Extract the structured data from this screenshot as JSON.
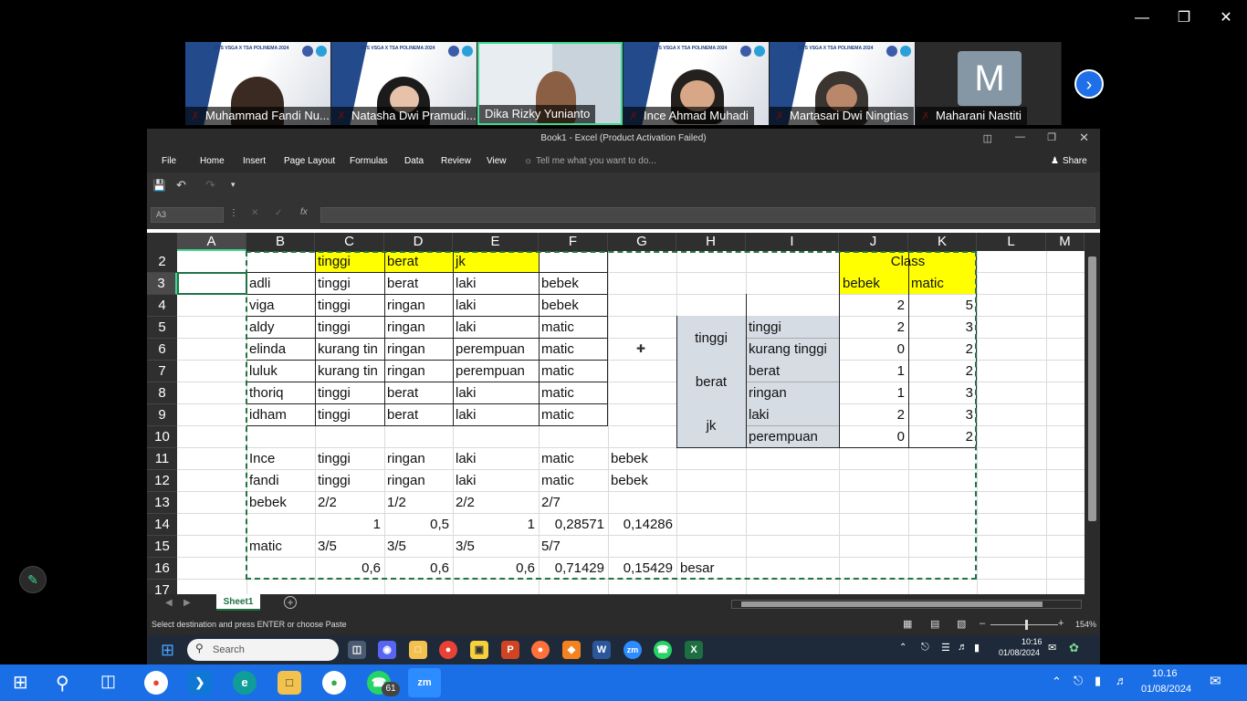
{
  "meeting": {
    "participants": [
      {
        "name": "Muhammad Fandi Nu...",
        "banner": "DTS VSGA X TSA POLINEMA 2024",
        "muted": true
      },
      {
        "name": "Natasha Dwi Pramudi...",
        "banner": "DTS VSGA X TSA POLINEMA 2024",
        "muted": true
      },
      {
        "name": "Dika Rizky Yunianto",
        "banner": "",
        "muted": false,
        "active": true
      },
      {
        "name": "Ince Ahmad Muhadi",
        "banner": "DTS VSGA X TSA POLINEMA 2024",
        "muted": true
      },
      {
        "name": "Martasari Dwi Ningtias",
        "banner": "DTS VSGA X TSA POLINEMA 2024",
        "muted": true
      },
      {
        "name": "Maharani Nastiti",
        "avatar_letter": "M",
        "muted": true
      }
    ],
    "next_icon": "chevron-right-icon"
  },
  "excel": {
    "title": "Book1 - Excel (Product Activation Failed)",
    "menu": [
      "File",
      "Home",
      "Insert",
      "Page Layout",
      "Formulas",
      "Data",
      "Review",
      "View"
    ],
    "tell_me": "Tell me what you want to do...",
    "share": "Share",
    "name_box": "A3",
    "formula_value": "",
    "columns": [
      "A",
      "B",
      "C",
      "D",
      "E",
      "F",
      "G",
      "H",
      "I",
      "J",
      "K",
      "L",
      "M"
    ],
    "rows": [
      "2",
      "3",
      "4",
      "5",
      "6",
      "7",
      "8",
      "9",
      "10",
      "11",
      "12",
      "13",
      "14",
      "15",
      "16",
      "17"
    ],
    "table_header": {
      "c": "tinggi",
      "d": "berat",
      "e": "jk"
    },
    "data_rows": [
      [
        "adli",
        "tinggi",
        "berat",
        "laki",
        "bebek"
      ],
      [
        "viga",
        "tinggi",
        "ringan",
        "laki",
        "bebek"
      ],
      [
        "aldy",
        "tinggi",
        "ringan",
        "laki",
        "matic"
      ],
      [
        "elinda",
        "kurang tin",
        "ringan",
        "perempuan",
        "matic"
      ],
      [
        "luluk",
        "kurang tin",
        "ringan",
        "perempuan",
        "matic"
      ],
      [
        "thoriq",
        "tinggi",
        "berat",
        "laki",
        "matic"
      ],
      [
        "idham",
        "tinggi",
        "berat",
        "laki",
        "matic"
      ]
    ],
    "test_rows": [
      [
        "Ince",
        "tinggi",
        "ringan",
        "laki",
        "matic",
        "bebek"
      ],
      [
        "fandi",
        "tinggi",
        "ringan",
        "laki",
        "matic",
        "bebek"
      ]
    ],
    "calc": {
      "bebek_label": "bebek",
      "bebek_frac": [
        "2/2",
        "1/2",
        "2/2",
        "2/7"
      ],
      "bebek_vals": [
        "1",
        "0,5",
        "1",
        "0,28571",
        "0,14286"
      ],
      "matic_label": "matic",
      "matic_frac": [
        "3/5",
        "3/5",
        "3/5",
        "5/7"
      ],
      "matic_vals": [
        "0,6",
        "0,6",
        "0,6",
        "0,71429",
        "0,15429"
      ],
      "result": "besar"
    },
    "class_table": {
      "title": "Class",
      "headers": [
        "bebek",
        "matic"
      ],
      "total": [
        "2",
        "5"
      ],
      "groups": [
        {
          "label": "tinggi",
          "items": [
            [
              "tinggi",
              "2",
              "3"
            ],
            [
              "kurang tinggi",
              "0",
              "2"
            ]
          ]
        },
        {
          "label": "berat",
          "items": [
            [
              "berat",
              "1",
              "2"
            ],
            [
              "ringan",
              "1",
              "3"
            ]
          ]
        },
        {
          "label": "jk",
          "items": [
            [
              "laki",
              "2",
              "3"
            ],
            [
              "perempuan",
              "0",
              "2"
            ]
          ]
        }
      ]
    },
    "sheet_tab": "Sheet1",
    "status": "Select destination and press ENTER or choose Paste",
    "zoom": "154%"
  },
  "inner_taskbar": {
    "search_placeholder": "Search",
    "time": "10:16",
    "date": "01/08/2024"
  },
  "outer_taskbar": {
    "time": "10.16",
    "date": "01/08/2024",
    "whatsapp_badge": "61"
  },
  "colors": {
    "yellow": "#ffff00",
    "gray_fill": "#d6dce4",
    "excel_green": "#1d6f42",
    "taskbar_blue": "#1b6fe6"
  }
}
